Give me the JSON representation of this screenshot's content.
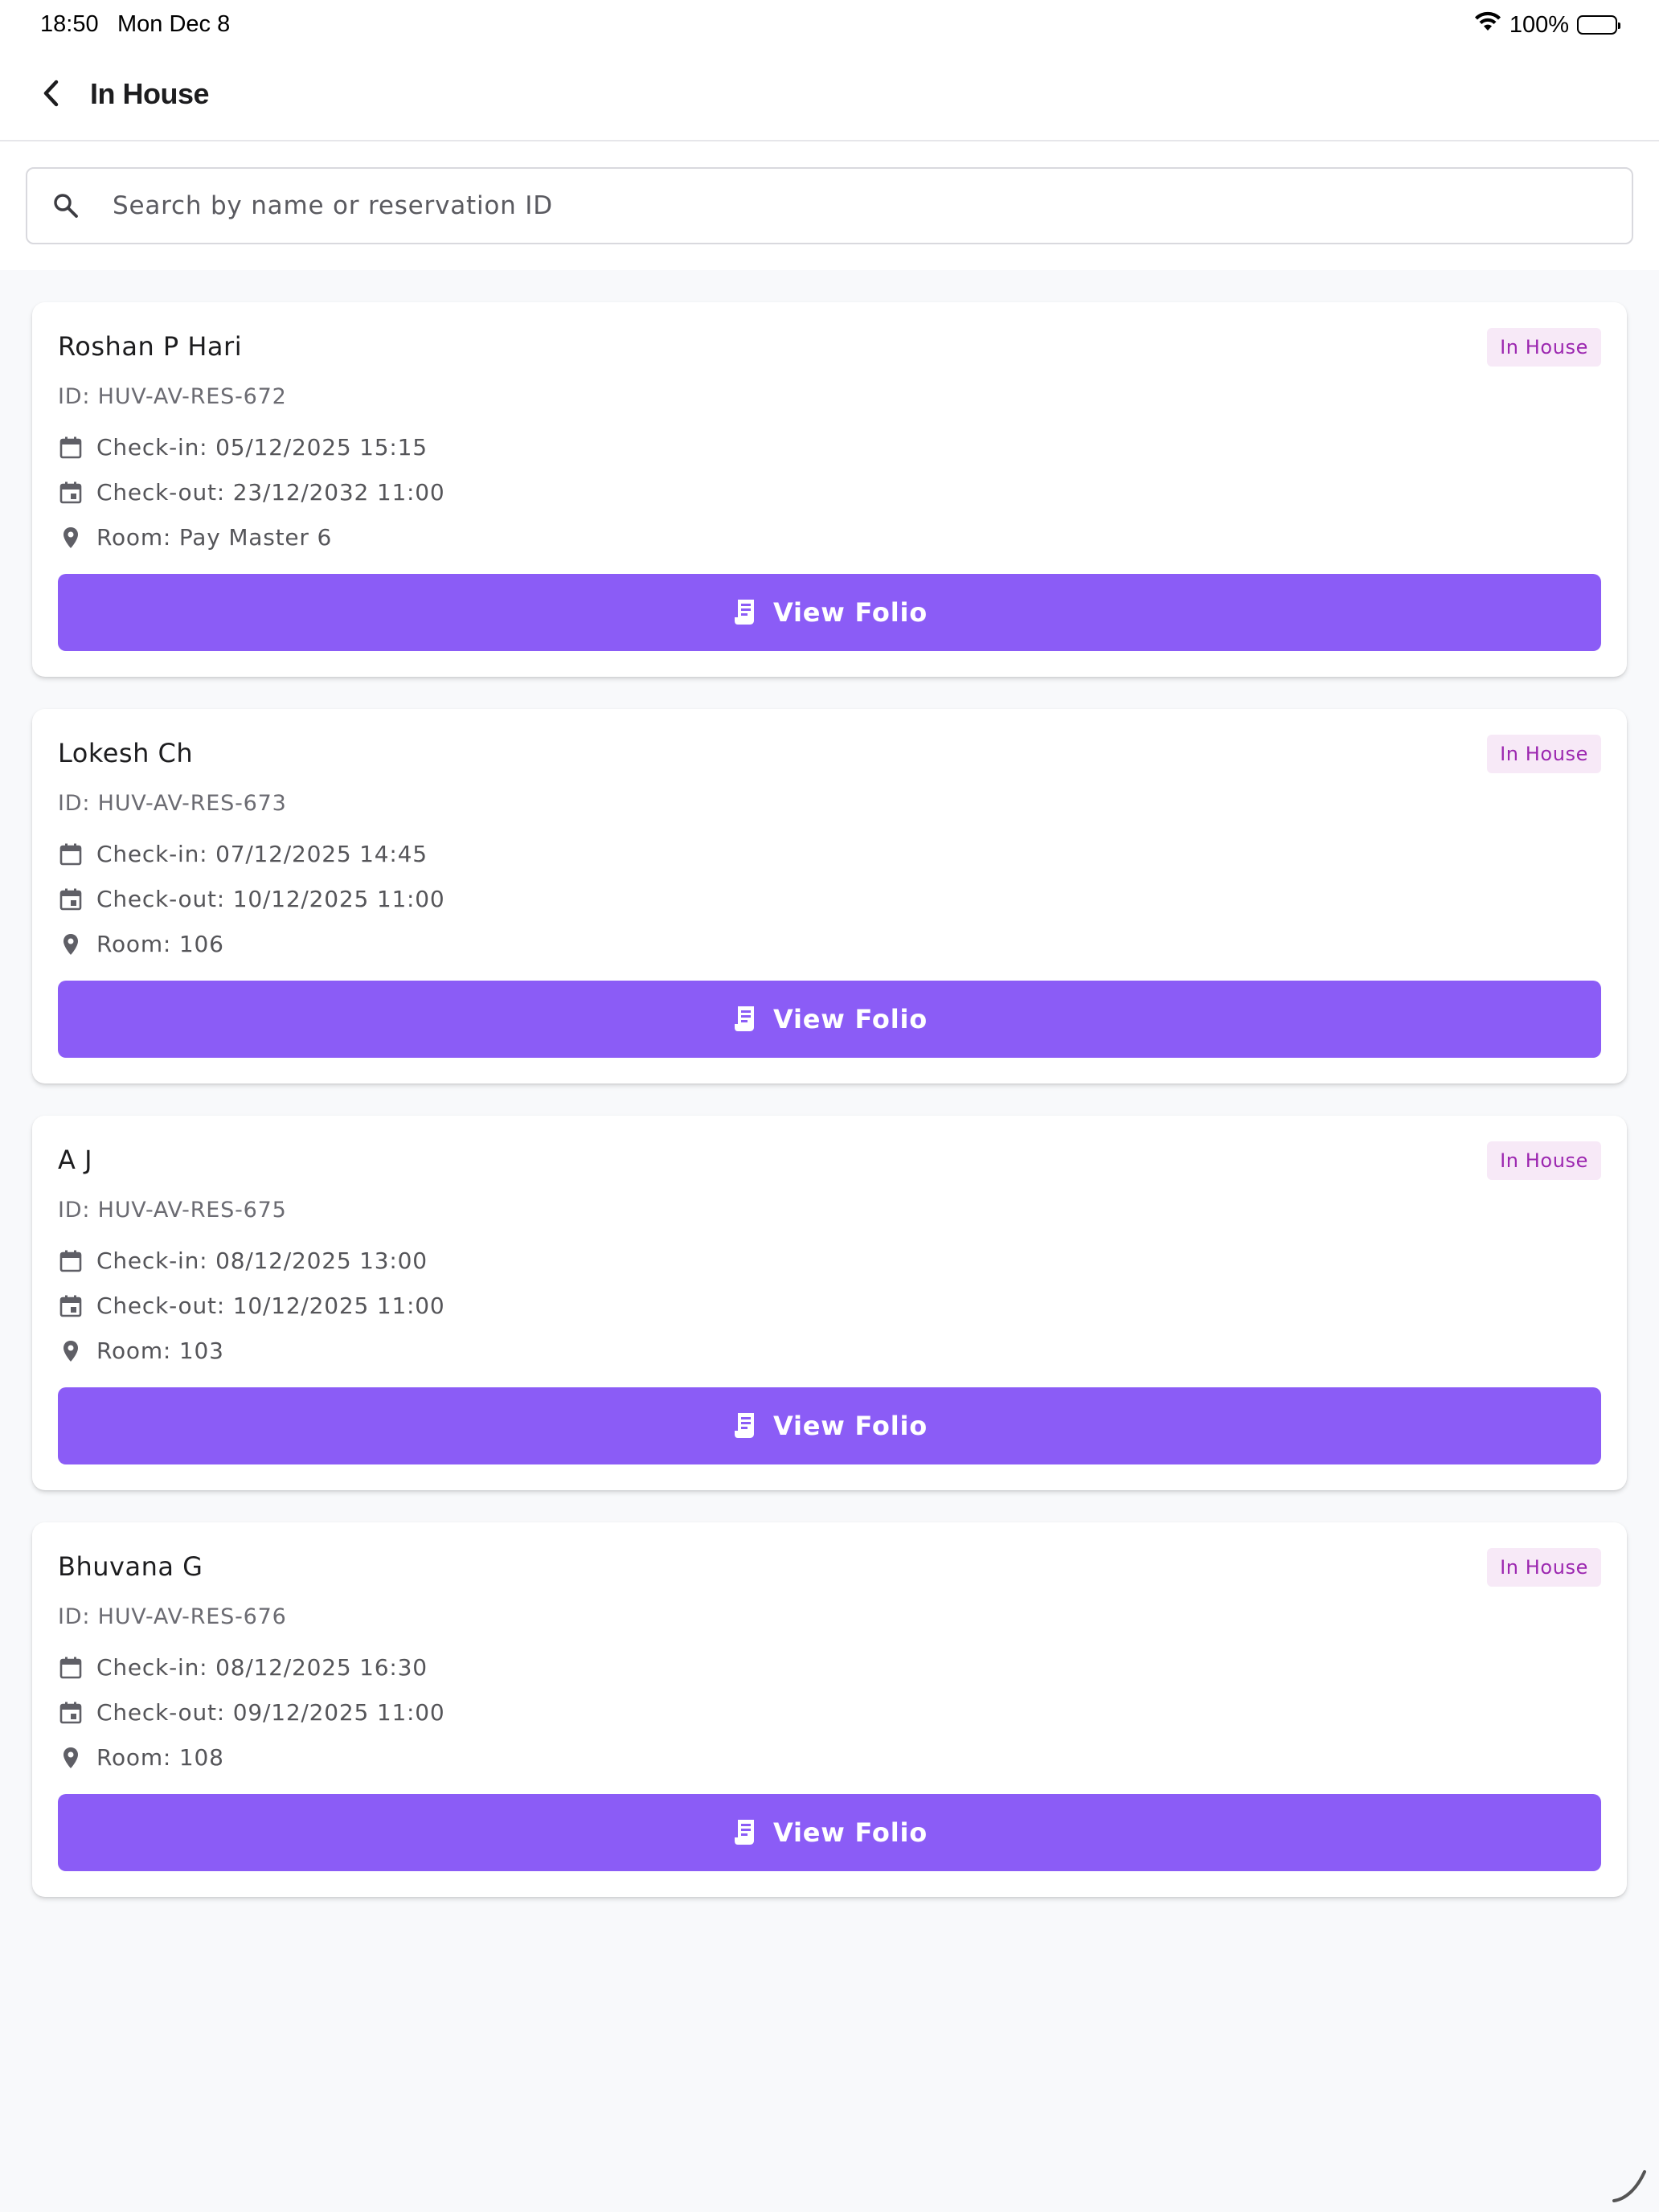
{
  "status_bar": {
    "time": "18:50",
    "date": "Mon Dec 8",
    "battery": "100%",
    "icons": [
      "wifi-icon",
      "battery-icon"
    ]
  },
  "app_bar": {
    "title": "In House",
    "back_icon": "chevron-left-icon"
  },
  "search": {
    "placeholder": "Search by name or reservation ID",
    "value": "",
    "icon": "search-icon"
  },
  "button_label": "View Folio",
  "colors": {
    "accent": "#8b5cf6",
    "badge_bg": "#f7e9f7",
    "badge_text": "#9c27b0",
    "background": "#f8f9fb"
  },
  "reservations": [
    {
      "name": "Roshan P Hari",
      "status": "In House",
      "id": "ID: HUV-AV-RES-672",
      "check_in": "Check-in: 05/12/2025 15:15",
      "check_out": "Check-out: 23/12/2032 11:00",
      "room": "Room: Pay Master 6"
    },
    {
      "name": "Lokesh Ch",
      "status": "In House",
      "id": "ID: HUV-AV-RES-673",
      "check_in": "Check-in: 07/12/2025 14:45",
      "check_out": "Check-out: 10/12/2025 11:00",
      "room": "Room: 106"
    },
    {
      "name": "A J",
      "status": "In House",
      "id": "ID: HUV-AV-RES-675",
      "check_in": "Check-in: 08/12/2025 13:00",
      "check_out": "Check-out: 10/12/2025 11:00",
      "room": "Room: 103"
    },
    {
      "name": "Bhuvana G",
      "status": "In House",
      "id": "ID: HUV-AV-RES-676",
      "check_in": "Check-in: 08/12/2025 16:30",
      "check_out": "Check-out: 09/12/2025 11:00",
      "room": "Room: 108"
    }
  ]
}
